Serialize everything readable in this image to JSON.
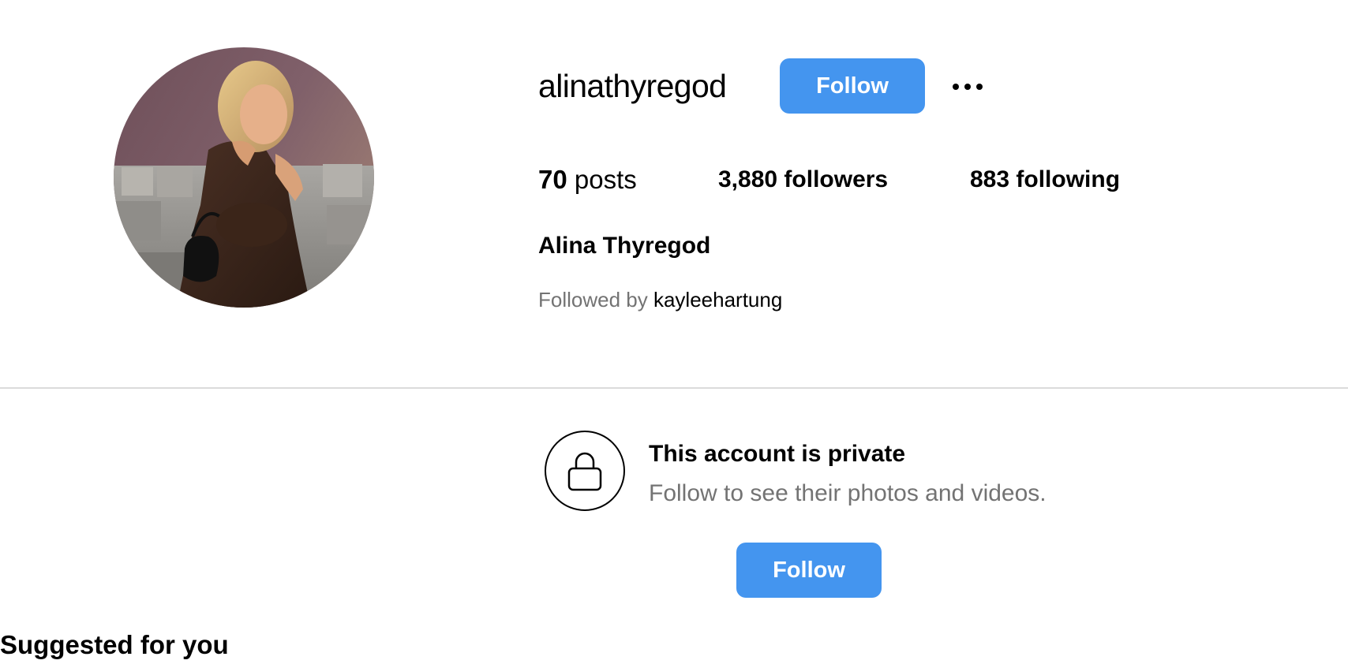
{
  "profile": {
    "username": "alinathyregod",
    "full_name": "Alina Thyregod",
    "follow_label": "Follow",
    "more_icon": "more-horizontal-icon",
    "stats": {
      "posts_count": "70",
      "posts_label": "posts",
      "followers_count": "3,880",
      "followers_label": "followers",
      "following_count": "883",
      "following_label": "following"
    },
    "followed_by_prefix": "Followed by",
    "followed_by_user": "kayleehartung"
  },
  "private_notice": {
    "icon": "lock-icon",
    "title": "This account is private",
    "subtitle": "Follow to see their photos and videos.",
    "follow_label": "Follow"
  },
  "suggested": {
    "title": "Suggested for you"
  },
  "colors": {
    "accent": "#4495ef",
    "secondary_text": "#737373",
    "divider": "#dbdbdb"
  }
}
